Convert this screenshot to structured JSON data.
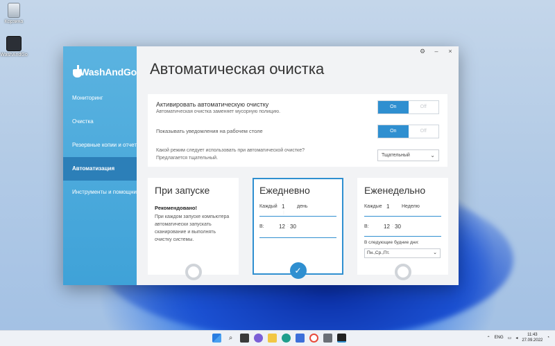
{
  "desktop": {
    "icons": [
      {
        "label": "Корзина",
        "icon": "recycle-bin-icon"
      },
      {
        "label": "WashAndGo",
        "icon": "washandgo-app-icon"
      }
    ]
  },
  "app": {
    "logo_text": "WashAndGo",
    "window_controls": {
      "settings": "⚙",
      "minimize": "–",
      "close": "×"
    }
  },
  "sidebar": {
    "items": [
      {
        "label": "Мониторинг",
        "active": false
      },
      {
        "label": "Очистка",
        "active": false
      },
      {
        "label": "Резервные копии и отчеты",
        "active": false
      },
      {
        "label": "Автоматизация",
        "active": true
      },
      {
        "label": "Инструменты и помощник",
        "active": false
      }
    ]
  },
  "page": {
    "title": "Автоматическая очистка"
  },
  "settings": {
    "auto_clean": {
      "title": "Активировать автоматическую очистку",
      "subtitle": "Автоматическая очистка заменяет мусорную полицию.",
      "on_label": "On",
      "off_label": "Off",
      "value": "On"
    },
    "notifications": {
      "title": "Показывать уведомления на рабочем столе",
      "on_label": "On",
      "off_label": "Off",
      "value": "On"
    },
    "mode": {
      "question": "Какой режим следует использовать при автоматической очистке?",
      "hint": "Предлагается тщательный.",
      "selected": "Тщательный"
    }
  },
  "schedules": {
    "startup": {
      "title": "При запуске",
      "rec_title": "Рекомендовано!",
      "rec_text": "При каждом запуске компьютера автоматически запускать сканирование и выполнять очистку системы.",
      "selected": false
    },
    "daily": {
      "title": "Ежедневно",
      "every_label": "Каждый",
      "every_value": "1",
      "unit": "день",
      "at_label": "В:",
      "hour": "12",
      "minute": "30",
      "selected": true,
      "check": "✓"
    },
    "weekly": {
      "title": "Еженедельно",
      "every_label": "Каждые",
      "every_value": "1",
      "unit": "Неделю",
      "at_label": "В:",
      "hour": "12",
      "minute": "30",
      "days_label": "В следующие будние дни:",
      "days_value": "Пн.,Ср.,Пт.",
      "selected": false
    }
  },
  "taskbar": {
    "language": "ENG",
    "time": "11:43",
    "date": "27.09.2022"
  },
  "colors": {
    "accent": "#2f8fd0",
    "sidebar": "#4fa9dc",
    "sidebar_active": "#2c7fb8"
  }
}
